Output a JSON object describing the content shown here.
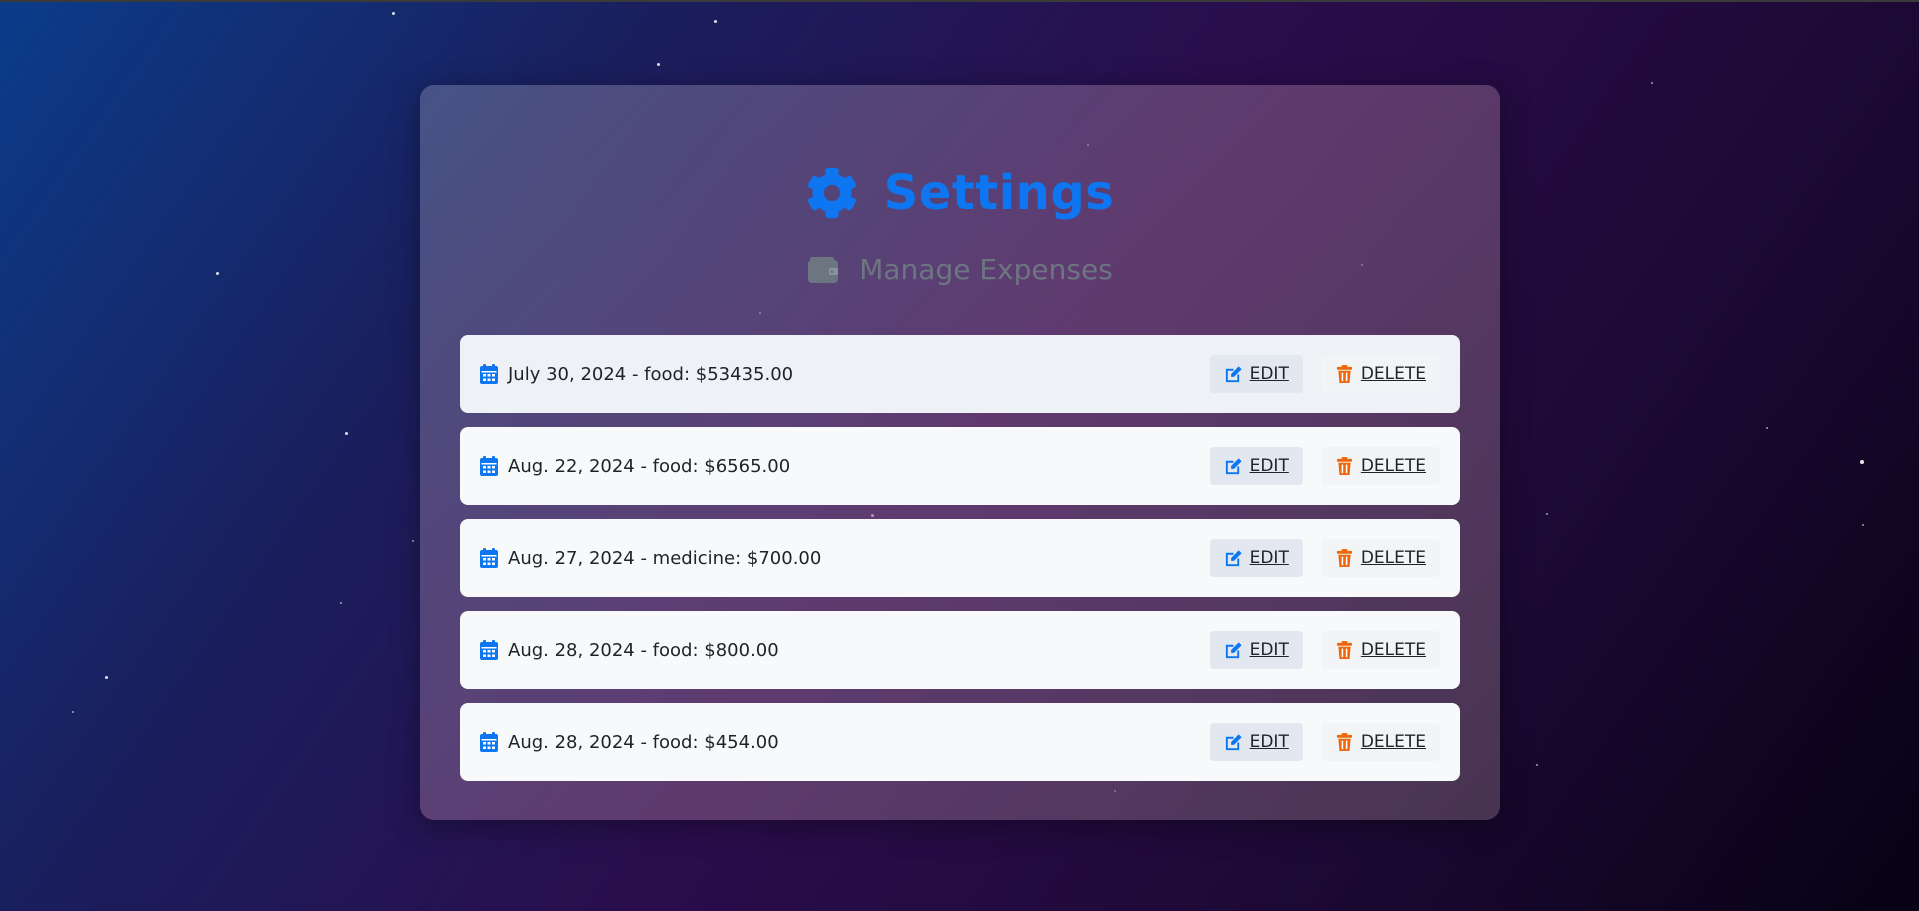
{
  "page": {
    "title": "Settings",
    "subtitle": "Manage Expenses",
    "accent_color": "#0d76f0",
    "delete_color": "#f0680d"
  },
  "icons": {
    "title": "gear-icon",
    "subtitle": "wallet-icon",
    "row": "calendar-icon",
    "edit": "edit-icon",
    "delete": "trash-icon"
  },
  "actions": {
    "edit_label": "EDIT",
    "delete_label": "DELETE"
  },
  "expenses": [
    {
      "text": "July 30, 2024 - food: $53435.00"
    },
    {
      "text": "Aug. 22, 2024 - food: $6565.00"
    },
    {
      "text": "Aug. 27, 2024 - medicine: $700.00"
    },
    {
      "text": "Aug. 28, 2024 - food: $800.00"
    },
    {
      "text": "Aug. 28, 2024 - food: $454.00"
    }
  ]
}
